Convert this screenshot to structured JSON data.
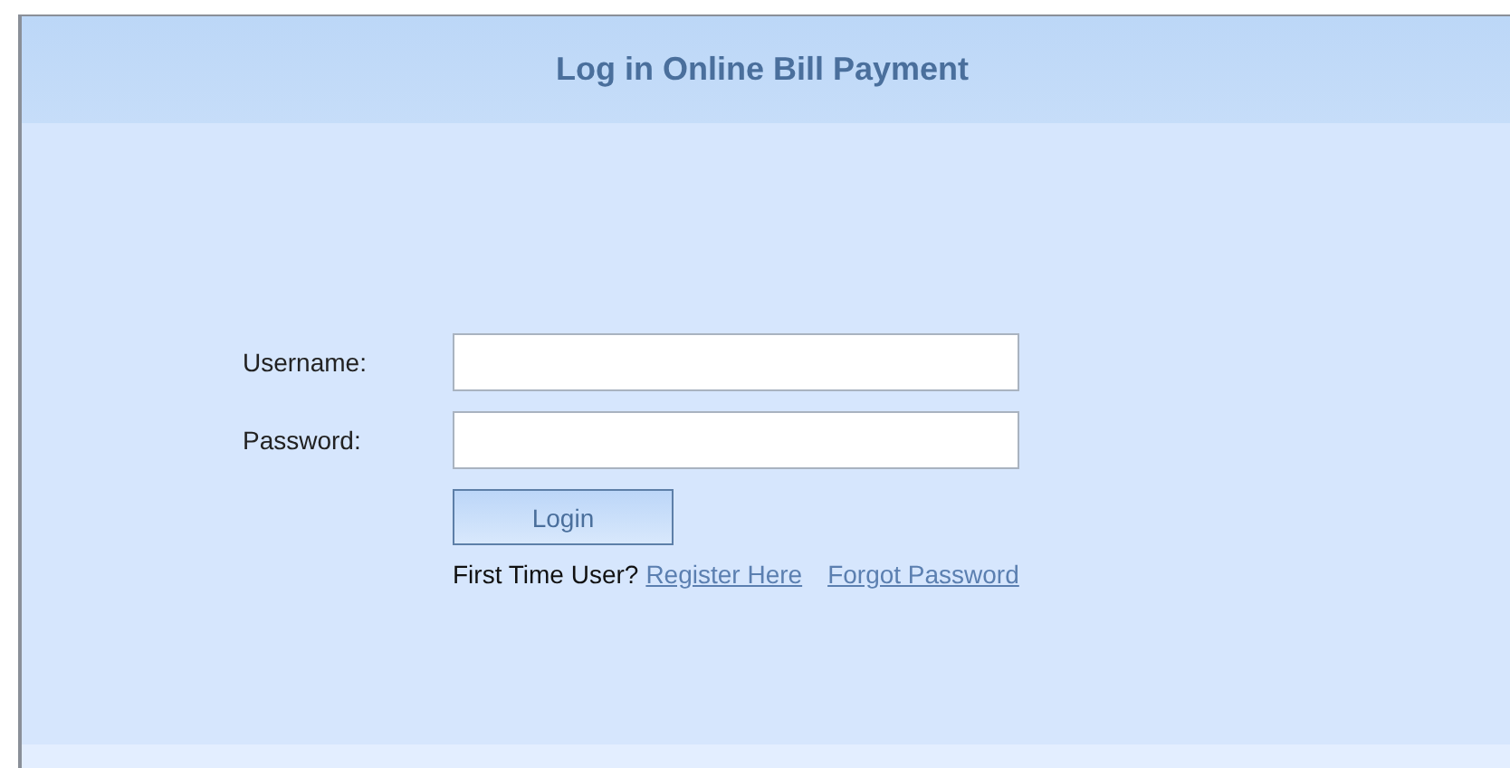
{
  "title": "Log in Online Bill Payment",
  "fields": [
    {
      "label": "Username:"
    },
    {
      "label": "Password:"
    }
  ],
  "login_button": "Login",
  "prompt": "First Time User?",
  "links": [
    "Register Here",
    "Forgot Password"
  ]
}
